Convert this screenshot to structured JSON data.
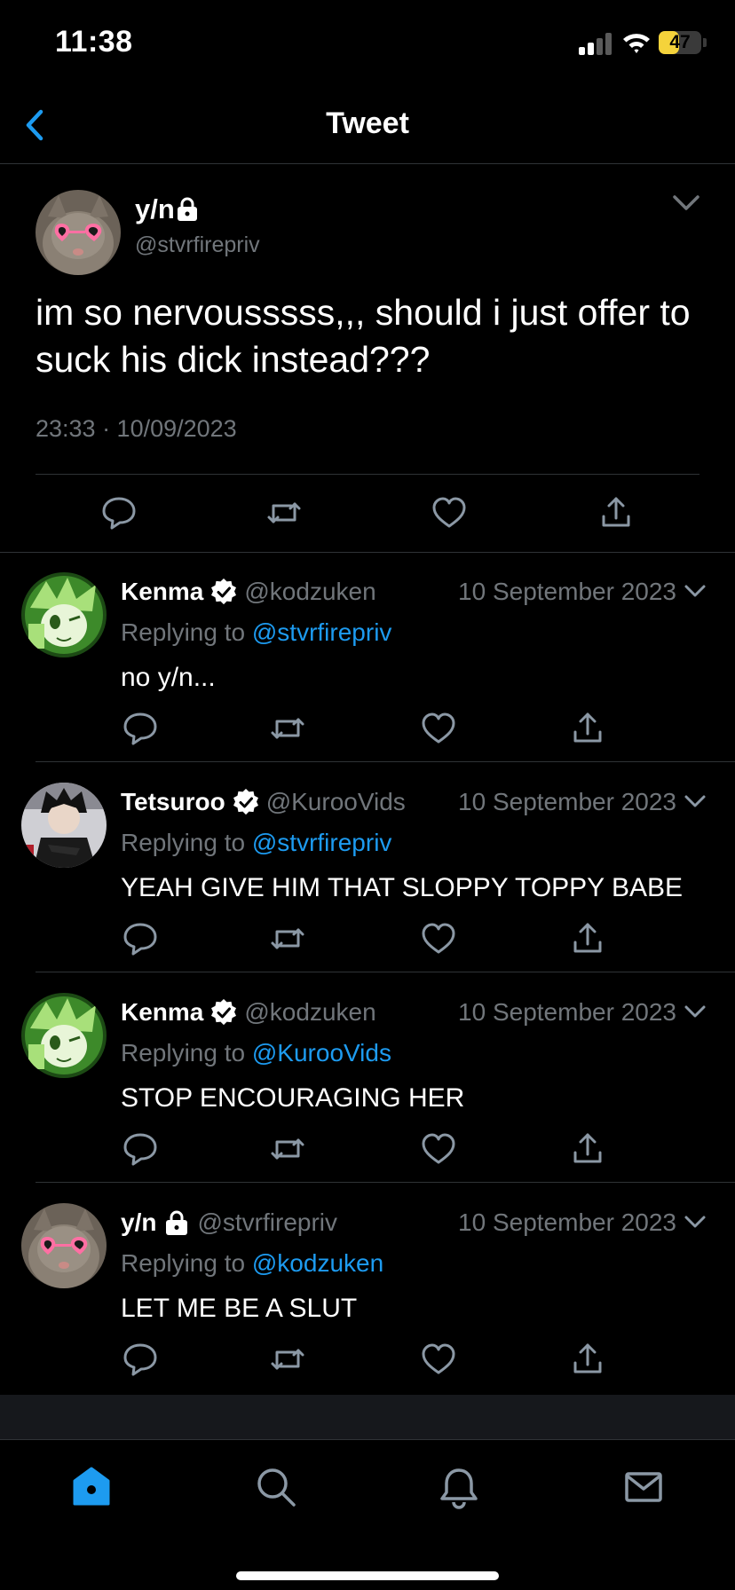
{
  "status_bar": {
    "time": "11:38",
    "battery": "47",
    "battery_level": 0.47
  },
  "nav": {
    "title": "Tweet"
  },
  "main_tweet": {
    "name": "y/n",
    "handle": "@stvrfirepriv",
    "text": "im so nervousssss,,, should i just offer to suck his dick instead???",
    "timestamp": "23:33 · 10/09/2023",
    "locked": true
  },
  "replies": [
    {
      "name": "Kenma",
      "verified": true,
      "handle": "@kodzuken",
      "date": "10 September 2023",
      "replying_prefix": "Replying to",
      "replying_to": "@stvrfirepriv",
      "text": "no y/n..."
    },
    {
      "name": "Tetsuroo",
      "verified": true,
      "handle": "@KurooVids",
      "date": "10 September 2023",
      "replying_prefix": "Replying to",
      "replying_to": "@stvrfirepriv",
      "text": "YEAH GIVE HIM THAT SLOPPY TOPPY BABE"
    },
    {
      "name": "Kenma",
      "verified": true,
      "handle": "@kodzuken",
      "date": "10 September 2023",
      "replying_prefix": "Replying to",
      "replying_to": "@KurooVids",
      "text": "STOP ENCOURAGING HER"
    },
    {
      "name": "y/n",
      "verified": false,
      "locked": true,
      "handle": "@stvrfirepriv",
      "date": "10 September 2023",
      "replying_prefix": "Replying to",
      "replying_to": "@kodzuken",
      "text": "LET ME BE A SLUT"
    }
  ],
  "tab_bar": {
    "tabs": [
      "home-icon",
      "search-icon",
      "bell-icon",
      "mail-icon"
    ],
    "active": "home-icon"
  },
  "colors": {
    "background": "#000000",
    "accent": "#1d9bf0",
    "muted_text": "#71767b",
    "divider": "#2f3336",
    "battery": "#f5d33b"
  }
}
